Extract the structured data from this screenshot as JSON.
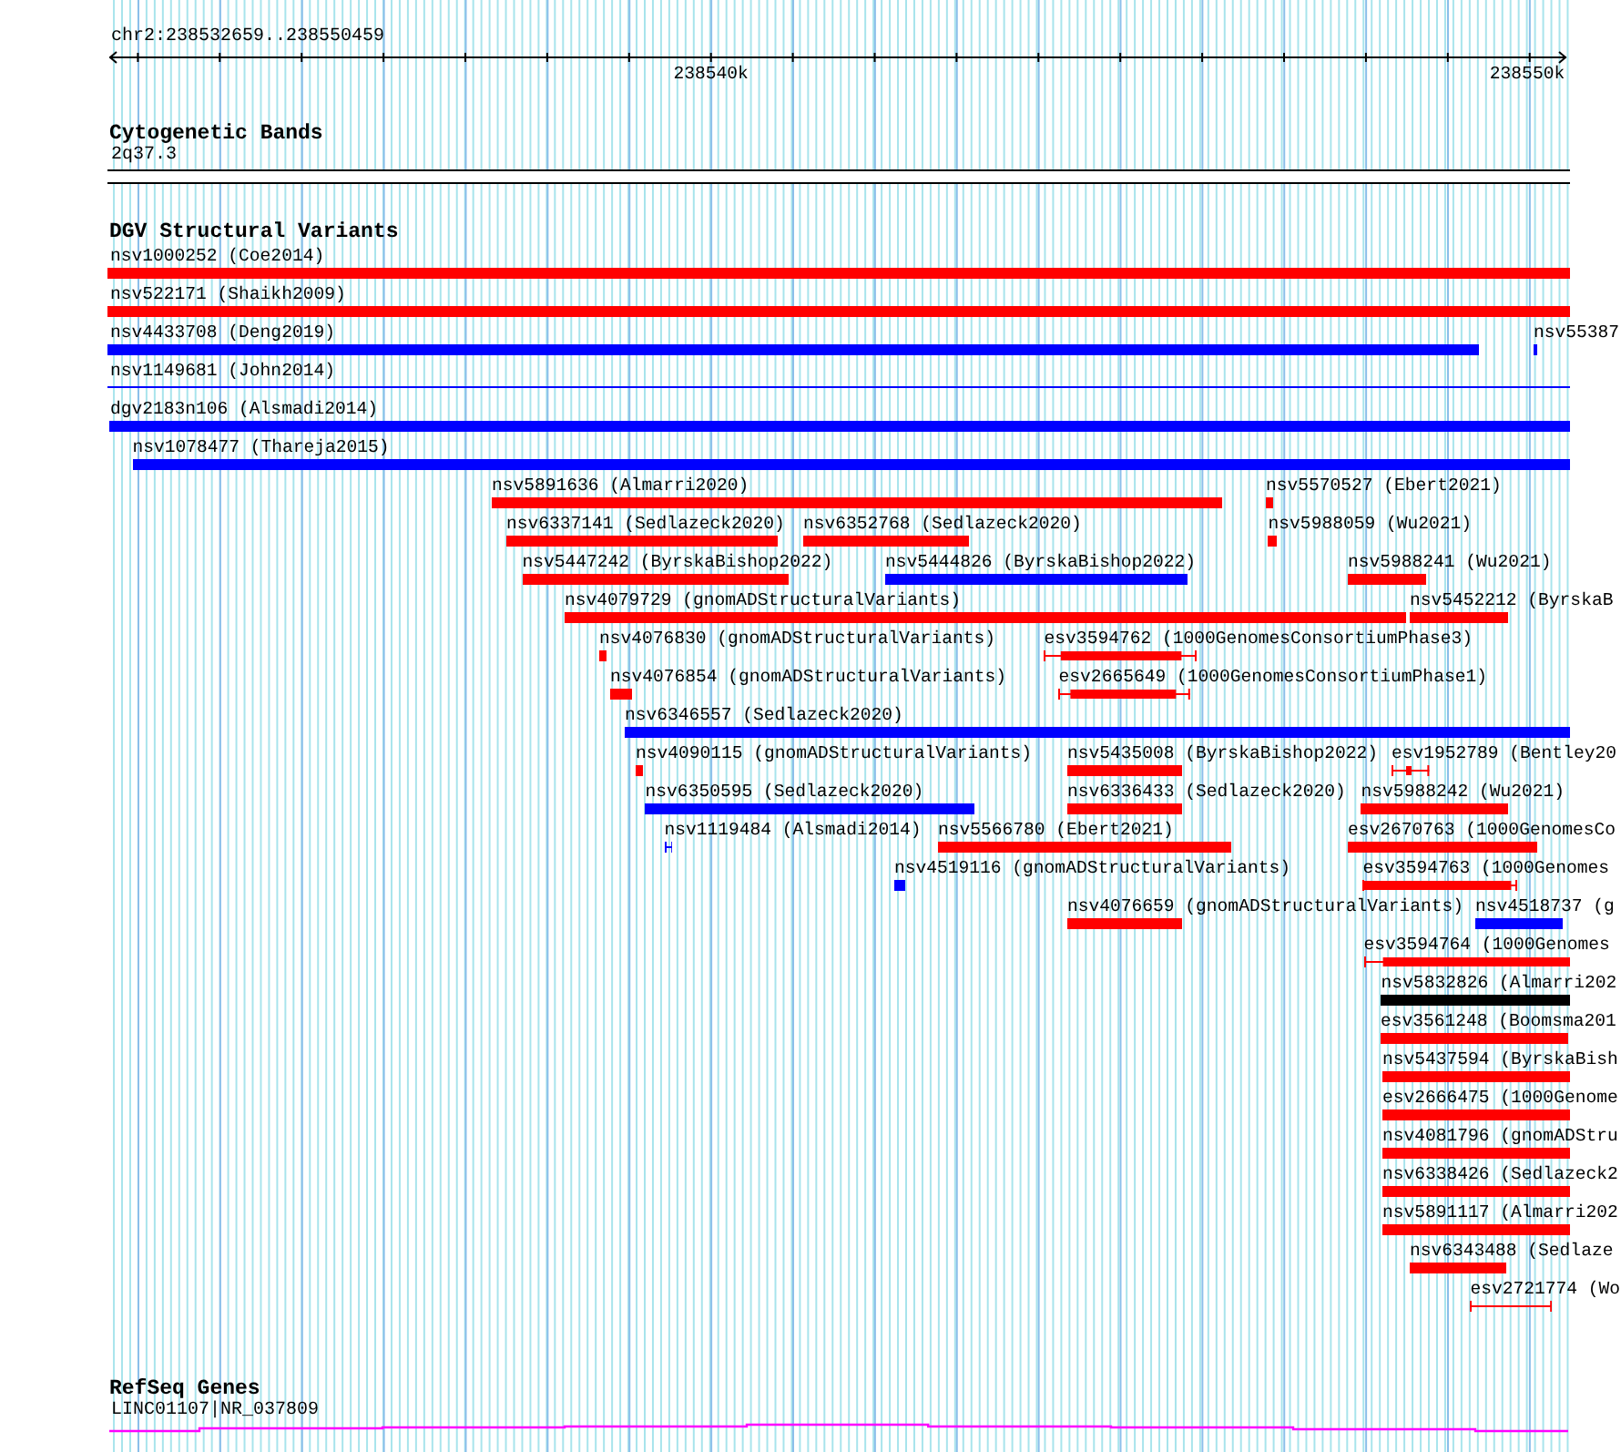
{
  "ruler": {
    "location": "chr2:238532659..238550459",
    "tick_labels": [
      "238540k",
      "238550k"
    ]
  },
  "cytoband_track": {
    "title": "Cytogenetic Bands",
    "band": {
      "label": "2q37.3"
    }
  },
  "variant_track": {
    "title": "DGV Structural Variants",
    "rows": [
      {
        "features": [
          {
            "label": "nsv1000252 (Coe2014)",
            "kind": "bar",
            "color": "#ff0000"
          }
        ]
      },
      {
        "features": [
          {
            "label": "nsv522171 (Shaikh2009)",
            "kind": "bar",
            "color": "#ff0000"
          }
        ]
      },
      {
        "features": [
          {
            "label": "nsv4433708 (Deng2019)",
            "kind": "bar",
            "color": "#0000ff"
          },
          {
            "label": "nsv55387",
            "kind": "bar",
            "color": "#0000ff"
          }
        ]
      },
      {
        "features": [
          {
            "label": "nsv1149681 (John2014)",
            "kind": "line",
            "color": "#0000ff"
          }
        ]
      },
      {
        "features": [
          {
            "label": "dgv2183n106 (Alsmadi2014)",
            "kind": "bar",
            "color": "#0000ff"
          }
        ]
      },
      {
        "features": [
          {
            "label": "nsv1078477 (Thareja2015)",
            "kind": "bar",
            "color": "#0000ff"
          }
        ]
      },
      {
        "features": [
          {
            "label": "nsv5891636 (Almarri2020)",
            "kind": "bar",
            "color": "#ff0000"
          },
          {
            "label": "nsv5570527 (Ebert2021)",
            "kind": "bar",
            "color": "#ff0000"
          }
        ]
      },
      {
        "features": [
          {
            "label": "nsv6337141 (Sedlazeck2020)",
            "kind": "bar",
            "color": "#ff0000"
          },
          {
            "label": "nsv6352768 (Sedlazeck2020)",
            "kind": "bar",
            "color": "#ff0000"
          },
          {
            "label": "nsv5988059 (Wu2021)",
            "kind": "bar",
            "color": "#ff0000"
          }
        ]
      },
      {
        "features": [
          {
            "label": "nsv5447242 (ByrskaBishop2022)",
            "kind": "bar",
            "color": "#ff0000"
          },
          {
            "label": "nsv5444826 (ByrskaBishop2022)",
            "kind": "bar",
            "color": "#0000ff"
          },
          {
            "label": "nsv5988241 (Wu2021)",
            "kind": "bar",
            "color": "#ff0000"
          }
        ]
      },
      {
        "features": [
          {
            "label": "nsv4079729 (gnomADStructuralVariants)",
            "kind": "bar",
            "color": "#ff0000"
          },
          {
            "label": "nsv5452212 (ByrskaB",
            "kind": "bar",
            "color": "#ff0000"
          }
        ]
      },
      {
        "features": [
          {
            "label": "nsv4076830 (gnomADStructuralVariants)",
            "kind": "bar",
            "color": "#ff0000"
          },
          {
            "label": "esv3594762 (1000GenomesConsortiumPhase3)",
            "kind": "whisker",
            "color": "#ff0000"
          }
        ]
      },
      {
        "features": [
          {
            "label": "nsv4076854 (gnomADStructuralVariants)",
            "kind": "bar",
            "color": "#ff0000"
          },
          {
            "label": "esv2665649 (1000GenomesConsortiumPhase1)",
            "kind": "whisker",
            "color": "#ff0000"
          }
        ]
      },
      {
        "features": [
          {
            "label": "nsv6346557 (Sedlazeck2020)",
            "kind": "bar",
            "color": "#0000ff"
          }
        ]
      },
      {
        "features": [
          {
            "label": "nsv4090115 (gnomADStructuralVariants)",
            "kind": "bar",
            "color": "#ff0000"
          },
          {
            "label": "nsv5435008 (ByrskaBishop2022)",
            "kind": "bar",
            "color": "#ff0000"
          },
          {
            "label": "esv1952789 (Bentley20",
            "kind": "whisker",
            "color": "#ff0000"
          }
        ]
      },
      {
        "features": [
          {
            "label": "nsv6350595 (Sedlazeck2020)",
            "kind": "bar",
            "color": "#0000ff"
          },
          {
            "label": "nsv6336433 (Sedlazeck2020)",
            "kind": "bar",
            "color": "#ff0000"
          },
          {
            "label": "nsv5988242 (Wu2021)",
            "kind": "bar",
            "color": "#ff0000"
          }
        ]
      },
      {
        "features": [
          {
            "label": "nsv1119484 (Alsmadi2014)",
            "kind": "whisker",
            "color": "#0000ff"
          },
          {
            "label": "nsv5566780 (Ebert2021)",
            "kind": "bar",
            "color": "#ff0000"
          },
          {
            "label": "esv2670763 (1000GenomesCo",
            "kind": "bar",
            "color": "#ff0000"
          }
        ]
      },
      {
        "features": [
          {
            "label": "nsv4519116 (gnomADStructuralVariants)",
            "kind": "bar",
            "color": "#0000ff"
          },
          {
            "label": "esv3594763 (1000Genomes",
            "kind": "whisker",
            "color": "#ff0000"
          }
        ]
      },
      {
        "features": [
          {
            "label": "nsv4076659 (gnomADStructuralVariants)",
            "kind": "bar",
            "color": "#ff0000"
          },
          {
            "label": "nsv4518737 (g",
            "kind": "bar",
            "color": "#0000ff"
          }
        ]
      },
      {
        "features": [
          {
            "label": "esv3594764 (1000Genomes",
            "kind": "whisker",
            "color": "#ff0000"
          }
        ]
      },
      {
        "features": [
          {
            "label": "nsv5832826 (Almarri202",
            "kind": "bar",
            "color": "#000000"
          }
        ]
      },
      {
        "features": [
          {
            "label": "esv3561248 (Boomsma201",
            "kind": "bar",
            "color": "#ff0000"
          }
        ]
      },
      {
        "features": [
          {
            "label": "nsv5437594 (ByrskaBish",
            "kind": "bar",
            "color": "#ff0000"
          }
        ]
      },
      {
        "features": [
          {
            "label": "esv2666475 (1000Genome",
            "kind": "bar",
            "color": "#ff0000"
          }
        ]
      },
      {
        "features": [
          {
            "label": "nsv4081796 (gnomADStru",
            "kind": "bar",
            "color": "#ff0000"
          }
        ]
      },
      {
        "features": [
          {
            "label": "nsv6338426 (Sedlazeck2",
            "kind": "bar",
            "color": "#ff0000"
          }
        ]
      },
      {
        "features": [
          {
            "label": "nsv5891117 (Almarri202",
            "kind": "bar",
            "color": "#ff0000"
          }
        ]
      },
      {
        "features": [
          {
            "label": "nsv6343488 (Sedlaze",
            "kind": "bar",
            "color": "#ff0000"
          }
        ]
      },
      {
        "features": [
          {
            "label": "esv2721774 (Wo",
            "kind": "whisker",
            "color": "#ff0000"
          }
        ]
      }
    ]
  },
  "gene_track": {
    "title": "RefSeq Genes",
    "gene": {
      "label": "LINC01107|NR_037809"
    }
  }
}
